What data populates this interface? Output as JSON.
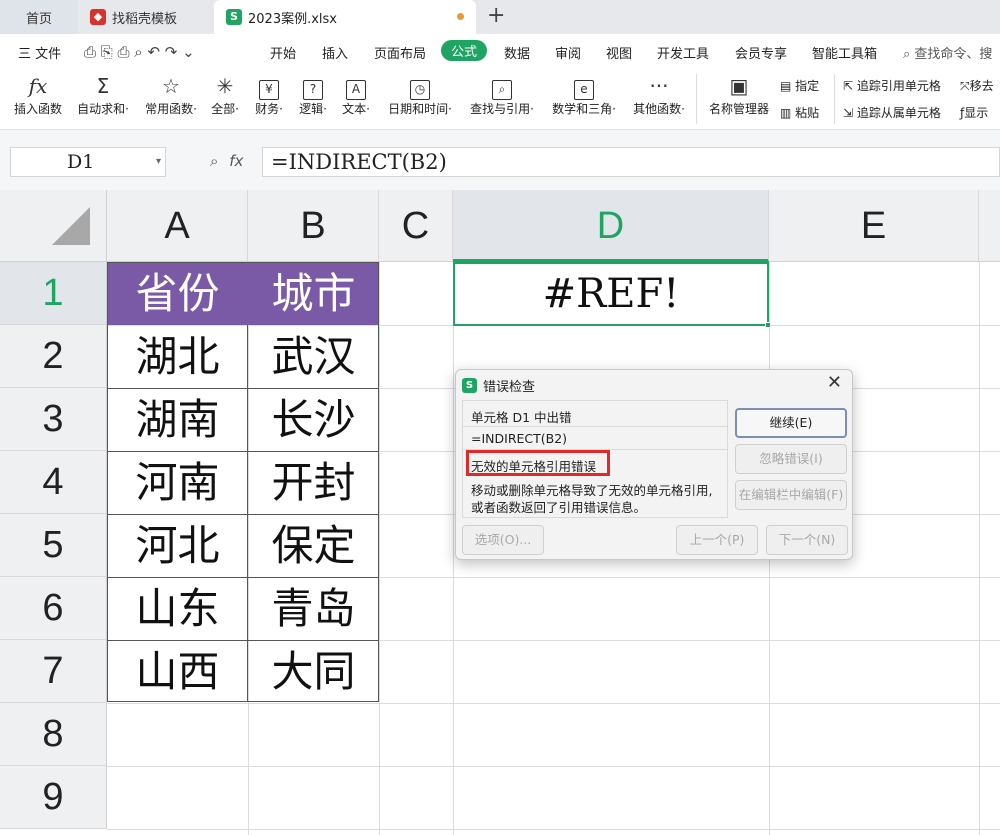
{
  "tabs": {
    "home": "首页",
    "template": "找稻壳模板",
    "file": "2023案例.xlsx",
    "add": "+"
  },
  "menu": {
    "file": "三 文件",
    "items": [
      "开始",
      "插入",
      "页面布局",
      "公式",
      "数据",
      "审阅",
      "视图",
      "开发工具",
      "会员专享",
      "智能工具箱"
    ],
    "active": "公式",
    "search": "查找命令、搜"
  },
  "ribbon": {
    "buttons": [
      "插入函数",
      "自动求和·",
      "常用函数·",
      "全部·",
      "财务·",
      "逻辑·",
      "文本·",
      "日期和时间·",
      "查找与引用·",
      "数学和三角·",
      "其他函数·",
      "名称管理器"
    ],
    "glyphs": [
      "fx",
      "Σ",
      "☆",
      "✳",
      "¥",
      "?",
      "A",
      "◷",
      "⌕",
      "e",
      "···",
      "▣"
    ],
    "small": {
      "assign": "指定",
      "paste": "粘贴",
      "trace_precedents": "追踪引用单元格",
      "trace_dependents": "追踪从属单元格",
      "move_arrows": "移去",
      "show_formulas": "显示"
    }
  },
  "formula_bar": {
    "name_box": "D1",
    "fx_label": "fx",
    "formula": "=INDIRECT(B2)"
  },
  "sheet": {
    "columns": [
      "A",
      "B",
      "C",
      "D",
      "E"
    ],
    "rows": [
      "1",
      "2",
      "3",
      "4",
      "5",
      "6",
      "7",
      "8",
      "9"
    ],
    "header_row": [
      "省份",
      "城市"
    ],
    "data": [
      [
        "湖北",
        "武汉"
      ],
      [
        "湖南",
        "长沙"
      ],
      [
        "河南",
        "开封"
      ],
      [
        "河北",
        "保定"
      ],
      [
        "山东",
        "青岛"
      ],
      [
        "山西",
        "大同"
      ]
    ],
    "d1_value": "#REF!",
    "header_fill": "#7a5aa6",
    "selection_color": "#1fa463"
  },
  "dialog": {
    "title": "错误检查",
    "cell_error": "单元格 D1 中出错",
    "formula": "=INDIRECT(B2)",
    "error_type": "无效的单元格引用错误",
    "description_1": "移动或删除单元格导致了无效的单元格引用,",
    "description_2": "或者函数返回了引用错误信息。",
    "buttons": {
      "continue": "继续(E)",
      "ignore": "忽略错误(I)",
      "edit_in_bar": "在编辑栏中编辑(F)",
      "options": "选项(O)...",
      "previous": "上一个(P)",
      "next": "下一个(N)"
    },
    "highlight_color": "#e02a2a"
  }
}
